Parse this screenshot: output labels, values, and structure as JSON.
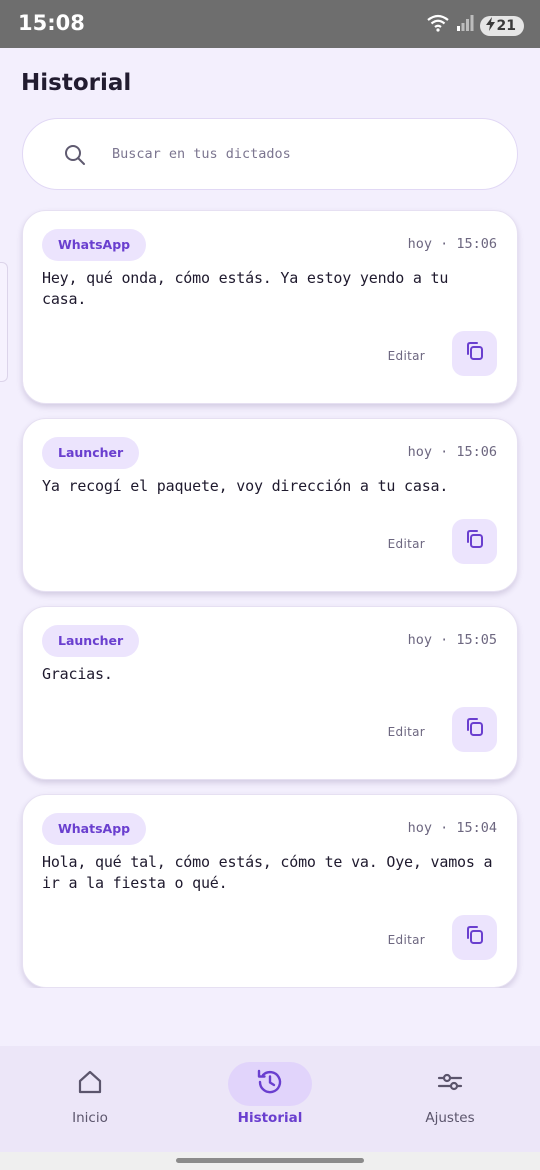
{
  "status_bar": {
    "time": "15:08",
    "battery_level": "21"
  },
  "header": {
    "title": "Historial"
  },
  "search": {
    "placeholder": "Buscar en tus dictados"
  },
  "entries": [
    {
      "app": "WhatsApp",
      "time": "hoy · 15:06",
      "text": "Hey, qué onda, cómo estás. Ya estoy yendo a tu casa.",
      "edit_label": "Editar"
    },
    {
      "app": "Launcher",
      "time": "hoy · 15:06",
      "text": "Ya recogí el paquete, voy dirección a tu casa.",
      "edit_label": "Editar"
    },
    {
      "app": "Launcher",
      "time": "hoy · 15:05",
      "text": "Gracias.",
      "edit_label": "Editar"
    },
    {
      "app": "WhatsApp",
      "time": "hoy · 15:04",
      "text": "Hola, qué tal, cómo estás, cómo te va. Oye, vamos a ir a la fiesta o qué.",
      "edit_label": "Editar"
    }
  ],
  "bottom_nav": {
    "items": [
      {
        "label": "Inicio",
        "icon": "home-icon",
        "active": false
      },
      {
        "label": "Historial",
        "icon": "history-icon",
        "active": true
      },
      {
        "label": "Ajustes",
        "icon": "sliders-icon",
        "active": false
      }
    ]
  },
  "colors": {
    "accent": "#6a3fcf",
    "chip_bg": "#ece4fd",
    "background": "#f3effd"
  }
}
